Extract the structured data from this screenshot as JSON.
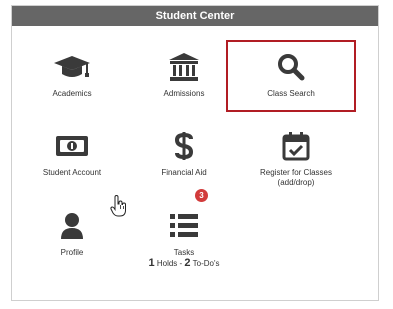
{
  "header": {
    "title": "Student Center"
  },
  "tiles": {
    "academics": {
      "label": "Academics"
    },
    "admissions": {
      "label": "Admissions"
    },
    "class_search": {
      "label": "Class Search"
    },
    "student_account": {
      "label": "Student Account"
    },
    "financial_aid": {
      "label": "Financial Aid"
    },
    "register": {
      "label_line1": "Register for Classes",
      "label_line2": "(add/drop)"
    },
    "profile": {
      "label": "Profile"
    },
    "tasks": {
      "label": "Tasks",
      "badge": "3",
      "holds_count": "1",
      "holds_label": "Holds -",
      "todos_count": "2",
      "todos_label": "To-Do's"
    }
  },
  "colors": {
    "header_bg": "#666666",
    "highlight": "#b11d24",
    "icon": "#3a3a3a",
    "badge": "#d23b3b"
  },
  "icons": {
    "academics": "graduation-cap-icon",
    "admissions": "institution-icon",
    "class_search": "search-icon",
    "student_account": "money-icon",
    "financial_aid": "dollar-icon",
    "register": "calendar-check-icon",
    "profile": "user-icon",
    "tasks": "list-icon",
    "cursor": "hand-pointer-icon"
  }
}
